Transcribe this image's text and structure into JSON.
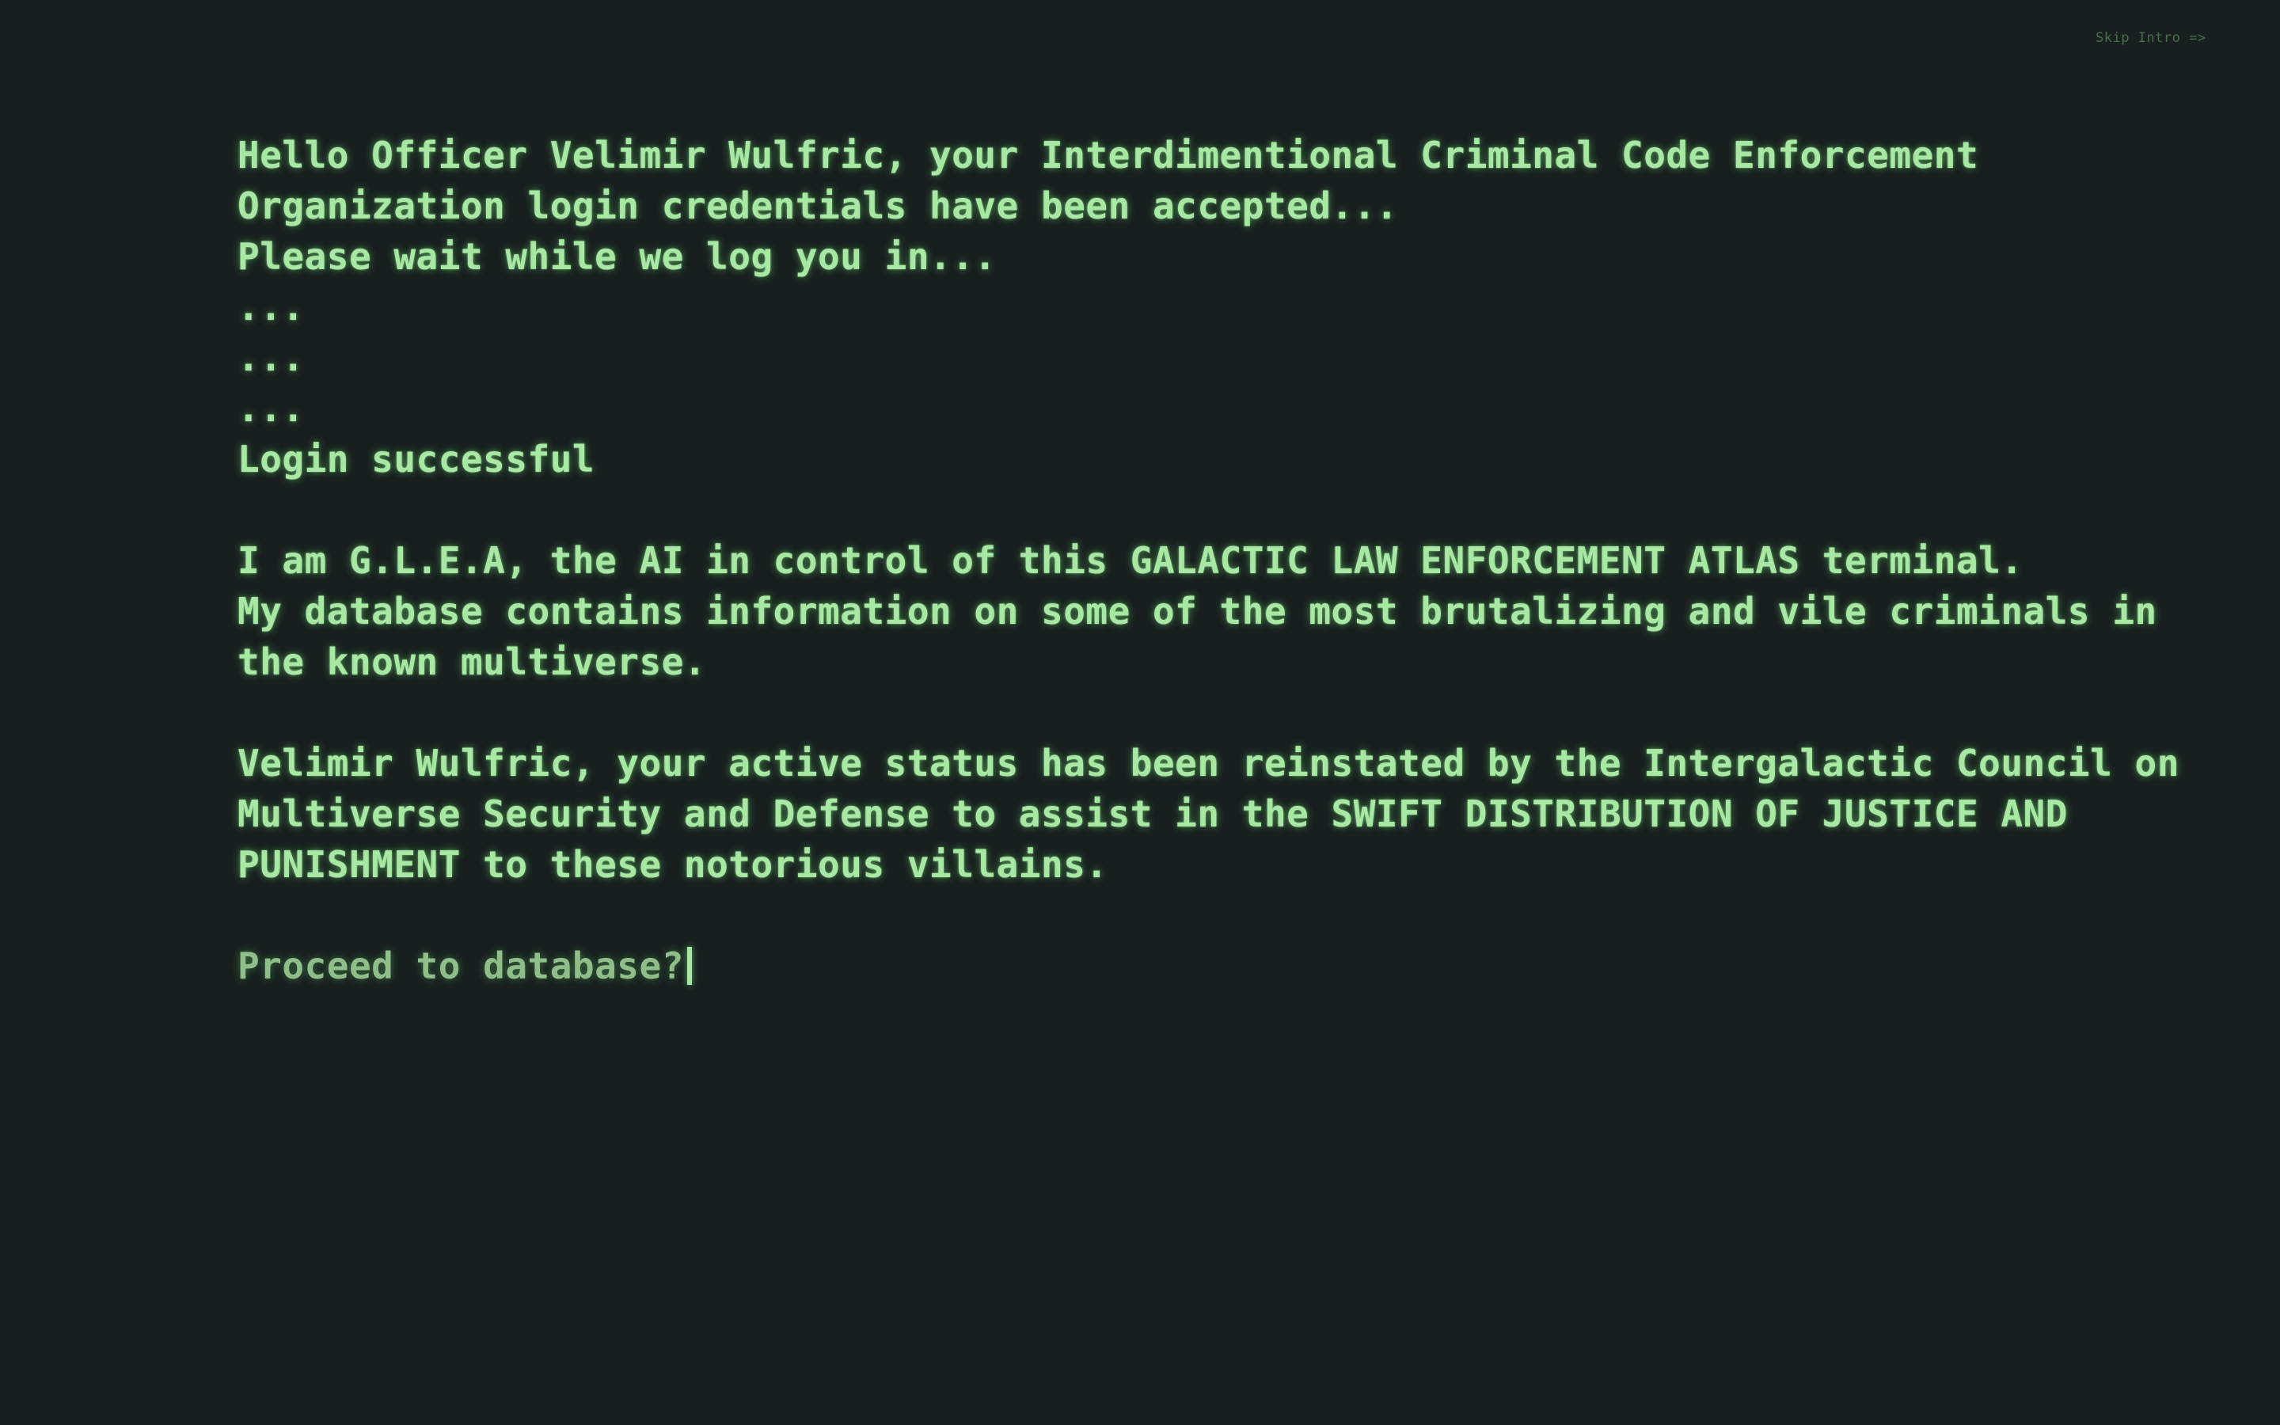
{
  "skip_intro_label": "Skip Intro =>",
  "terminal": {
    "greeting_lines": [
      "Hello Officer Velimir Wulfric, your Interdimentional Criminal Code Enforcement",
      "Organization login credentials have been accepted...",
      "Please wait while we log you in...",
      "...",
      "...",
      "...",
      "Login successful"
    ],
    "intro_lines": [
      "I am G.L.E.A, the AI in control of this GALACTIC LAW ENFORCEMENT ATLAS terminal.",
      "My database contains information on some of the most brutalizing and vile criminals in",
      "the known multiverse."
    ],
    "status_lines": [
      "Velimir Wulfric, your active status has been reinstated by the Intergalactic Council on",
      "Multiverse Security and Defense to assist in the SWIFT DISTRIBUTION OF JUSTICE AND",
      "PUNISHMENT to these notorious villains."
    ],
    "prompt": "Proceed to database?"
  },
  "colors": {
    "background": "#18201f",
    "text": "#a8e8a4",
    "prompt": "#8fbe8a",
    "skip_intro": "#4b6b4f"
  }
}
